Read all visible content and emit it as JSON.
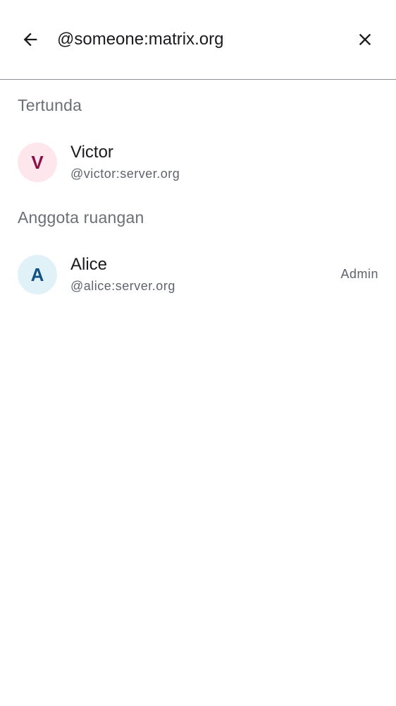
{
  "search": {
    "query": "@someone:matrix.org"
  },
  "icons": {
    "back": "arrow-left-icon",
    "clear": "close-icon"
  },
  "sections": {
    "pending": {
      "title": "Tertunda",
      "members": [
        {
          "initial": "V",
          "name": "Victor",
          "user_id": "@victor:server.org",
          "avatar_bg": "#fde6ec",
          "avatar_fg": "#8c1048"
        }
      ]
    },
    "room_members": {
      "title": "Anggota ruangan",
      "members": [
        {
          "initial": "A",
          "name": "Alice",
          "user_id": "@alice:server.org",
          "role": "Admin",
          "avatar_bg": "#e0f2f8",
          "avatar_fg": "#125286"
        }
      ]
    }
  }
}
